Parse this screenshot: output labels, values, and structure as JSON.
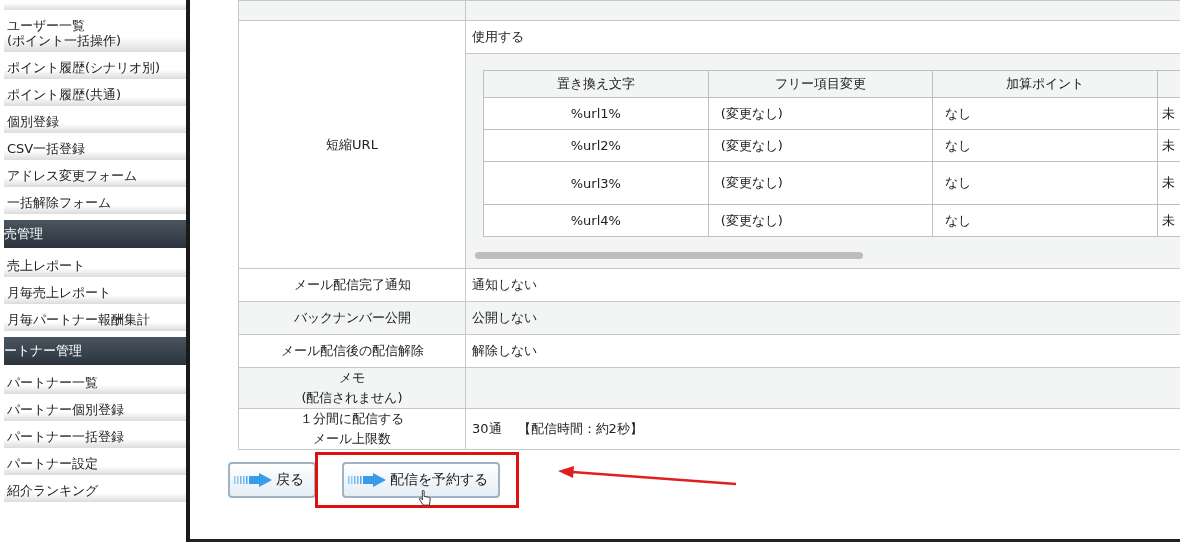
{
  "sidebar": {
    "items": [
      {
        "kind": "item",
        "label": "ユーザー一覧\n(ポイント一括操作)"
      },
      {
        "kind": "item",
        "label": "ポイント履歴(シナリオ別)"
      },
      {
        "kind": "item",
        "label": "ポイント履歴(共通)"
      },
      {
        "kind": "item",
        "label": "個別登録"
      },
      {
        "kind": "item",
        "label": "CSV一括登録"
      },
      {
        "kind": "item",
        "label": "アドレス変更フォーム"
      },
      {
        "kind": "item",
        "label": "一括解除フォーム"
      },
      {
        "kind": "header",
        "label": "売管理"
      },
      {
        "kind": "item",
        "label": "売上レポート"
      },
      {
        "kind": "item",
        "label": "月毎売上レポート"
      },
      {
        "kind": "item",
        "label": "月毎パートナー報酬集計"
      },
      {
        "kind": "header",
        "label": "ートナー管理"
      },
      {
        "kind": "item",
        "label": "パートナー一覧"
      },
      {
        "kind": "item",
        "label": "パートナー個別登録"
      },
      {
        "kind": "item",
        "label": "パートナー一括登録"
      },
      {
        "kind": "item",
        "label": "パートナー設定"
      },
      {
        "kind": "item",
        "label": "紹介ランキング"
      }
    ]
  },
  "short_url": {
    "label": "短縮URL",
    "value": "使用する",
    "columns": [
      "置き換え文字",
      "フリー項目変更",
      "加算ポイント"
    ],
    "rows": [
      {
        "tag": "%url1%",
        "field": "(変更なし)",
        "points": "なし",
        "column_4": "未"
      },
      {
        "tag": "%url2%",
        "field": "(変更なし)",
        "points": "なし",
        "column_4": "未"
      },
      {
        "tag": "%url3%",
        "field": "(変更なし)",
        "points": "なし",
        "column_4": "未"
      },
      {
        "tag": "%url4%",
        "field": "(変更なし)",
        "points": "なし",
        "column_4": "未"
      }
    ]
  },
  "settings": [
    {
      "label": [
        "メール配信完了通知"
      ],
      "value": "通知しない"
    },
    {
      "label": [
        "バックナンバー公開"
      ],
      "value": "公開しない"
    },
    {
      "label": [
        "メール配信後の配信解除"
      ],
      "value": "解除しない"
    },
    {
      "label": [
        "メモ",
        "(配信されません)"
      ]
    },
    {
      "label": [
        "１分間に配信する",
        "メール上限数"
      ],
      "value": "30通",
      "note": "【配信時間：約2秒】"
    }
  ],
  "buttons": [
    {
      "label": "戻る"
    },
    {
      "label": "配信を予約する"
    }
  ]
}
